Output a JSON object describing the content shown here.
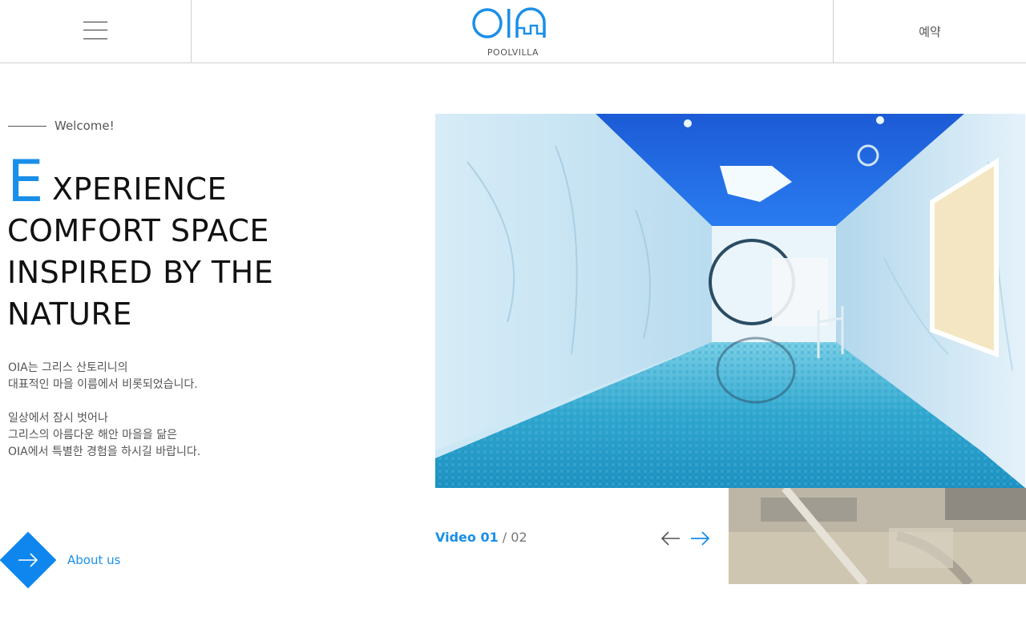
{
  "header": {
    "logo_text": "OIA",
    "logo_sub": "POOLVILLA",
    "reserve_label": "예약"
  },
  "hero": {
    "welcome": "Welcome!",
    "headline_first_letter": "E",
    "headline_line1": "XPERIENCE",
    "headline_line2": "COMFORT SPACE",
    "headline_line3": "INSPIRED BY THE",
    "headline_line4": "NATURE",
    "desc_p1_line1": "OIA는 그리스 산토리니의",
    "desc_p1_line2": "대표적인 마을 이름에서 비롯되었습니다.",
    "desc_p2_line1": "일상에서 잠시 벗어나",
    "desc_p2_line2": "그리스의 아름다운 해안 마을을 닮은",
    "desc_p2_line3": "OIA에서 특별한 경험을 하시길 바랍니다.",
    "about_label": "About us"
  },
  "slider": {
    "current_label": "Video 01",
    "separator": " / ",
    "total": "02"
  },
  "colors": {
    "accent": "#1a8fe8",
    "diamond": "#0e86ee",
    "border": "#cfcfcf"
  }
}
